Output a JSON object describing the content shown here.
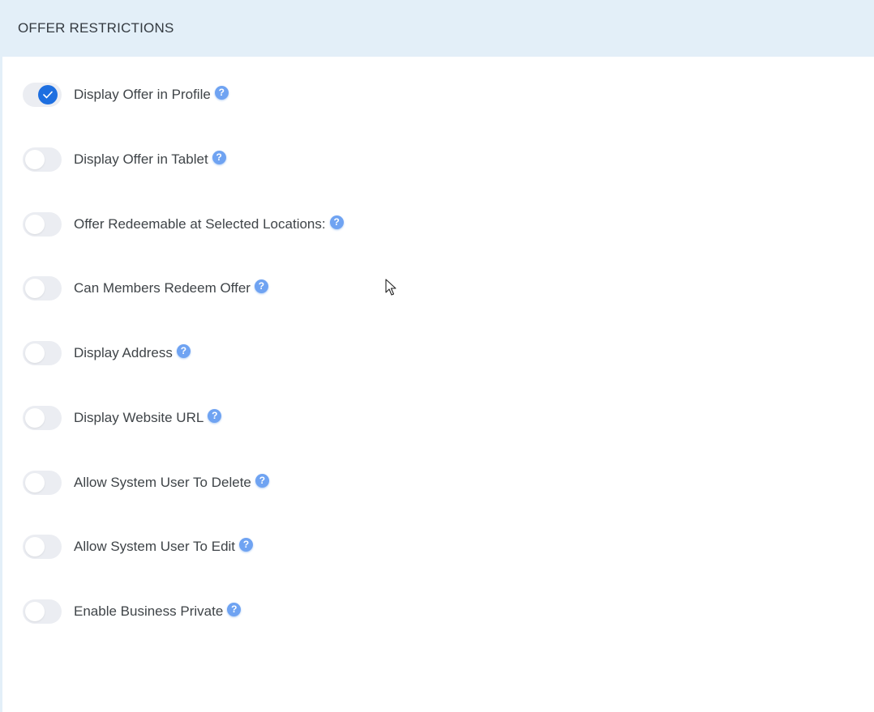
{
  "panel": {
    "title": "OFFER RESTRICTIONS"
  },
  "options": [
    {
      "label": "Display Offer in Profile",
      "enabled": true,
      "help_icon": "question-circle-icon"
    },
    {
      "label": "Display Offer in Tablet",
      "enabled": false,
      "help_icon": "question-circle-icon"
    },
    {
      "label": "Offer Redeemable at Selected Locations:",
      "enabled": false,
      "help_icon": "question-circle-icon"
    },
    {
      "label": "Can Members Redeem Offer",
      "enabled": false,
      "help_icon": "question-circle-icon"
    },
    {
      "label": "Display Address",
      "enabled": false,
      "help_icon": "question-circle-icon"
    },
    {
      "label": "Display Website URL",
      "enabled": false,
      "help_icon": "question-circle-icon"
    },
    {
      "label": "Allow System User To Delete",
      "enabled": false,
      "help_icon": "question-circle-icon"
    },
    {
      "label": "Allow System User To Edit",
      "enabled": false,
      "help_icon": "question-circle-icon"
    },
    {
      "label": "Enable Business Private",
      "enabled": false,
      "help_icon": "question-circle-icon"
    }
  ],
  "colors": {
    "header_bg": "#e3eff8",
    "toggle_on": "#1e6fe0",
    "toggle_off": "#ebedf2",
    "help_icon": "#6fa3f2"
  }
}
